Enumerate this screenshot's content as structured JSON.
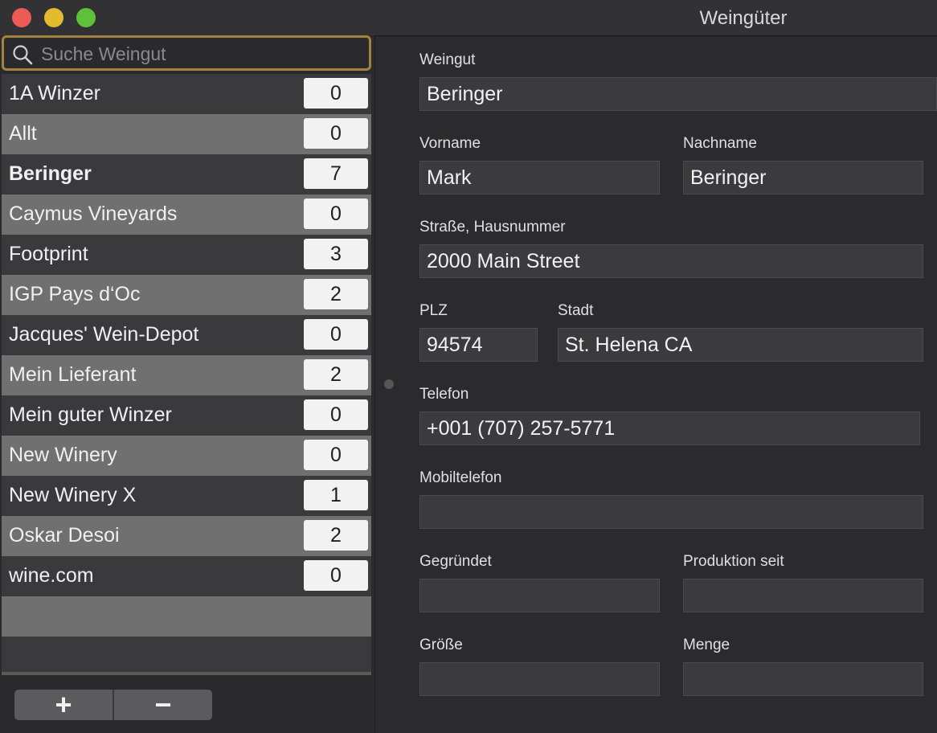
{
  "window": {
    "title": "Weingüter"
  },
  "sidebar": {
    "search": {
      "placeholder": "Suche Weingut",
      "value": ""
    },
    "items": [
      {
        "name": "1A Winzer",
        "count": "0"
      },
      {
        "name": "Allt",
        "count": "0"
      },
      {
        "name": "Beringer",
        "count": "7"
      },
      {
        "name": "Caymus Vineyards",
        "count": "0"
      },
      {
        "name": "Footprint",
        "count": "3"
      },
      {
        "name": "IGP Pays d‘Oc",
        "count": "2"
      },
      {
        "name": "Jacques' Wein-Depot",
        "count": "0"
      },
      {
        "name": "Mein Lieferant",
        "count": "2"
      },
      {
        "name": "Mein guter Winzer",
        "count": "0"
      },
      {
        "name": "New Winery",
        "count": "0"
      },
      {
        "name": "New Winery X",
        "count": "1"
      },
      {
        "name": "Oskar Desoi",
        "count": "2"
      },
      {
        "name": "wine.com",
        "count": "0"
      }
    ],
    "selected_item": "Beringer",
    "add_label": "+",
    "remove_label": "−"
  },
  "detail": {
    "weingut": {
      "label": "Weingut",
      "value": "Beringer"
    },
    "vorname": {
      "label": "Vorname",
      "value": "Mark"
    },
    "nachname": {
      "label": "Nachname",
      "value": "Beringer"
    },
    "strasse": {
      "label": "Straße, Hausnummer",
      "value": "2000 Main Street"
    },
    "plz": {
      "label": "PLZ",
      "value": "94574"
    },
    "stadt": {
      "label": "Stadt",
      "value": "St. Helena CA"
    },
    "telefon": {
      "label": "Telefon",
      "value": "+001 (707) 257-5771"
    },
    "mobil": {
      "label": "Mobiltelefon",
      "value": ""
    },
    "gegruendet": {
      "label": "Gegründet",
      "value": ""
    },
    "produktion": {
      "label": "Produktion seit",
      "value": ""
    },
    "groesse": {
      "label": "Größe",
      "value": ""
    },
    "menge": {
      "label": "Menge",
      "value": ""
    }
  },
  "colors": {
    "search_focus_ring": "#a4823f",
    "close": "#ee5b56",
    "minimize": "#e2bc2e",
    "maximize": "#5fc13a"
  }
}
